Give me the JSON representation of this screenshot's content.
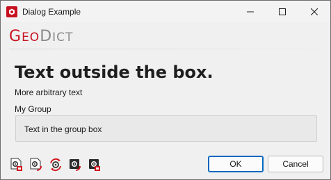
{
  "window": {
    "title": "Dialog Example"
  },
  "logo": {
    "geo_first": "G",
    "geo_rest": "EO",
    "dict_first": "D",
    "dict_rest": "ICT"
  },
  "main": {
    "heading": "Text outside the box.",
    "subtext": "More arbitrary text",
    "group_label": "My Group",
    "group_text": "Text in the group box"
  },
  "buttons": {
    "ok": "OK",
    "cancel": "Cancel"
  },
  "toolbar": {
    "icons": [
      "gear-pdf-icon",
      "gear-export-icon",
      "gear-refresh-icon",
      "gear-dark-export-icon",
      "gear-dark-pdf-icon"
    ]
  },
  "colors": {
    "brand_red": "#c8101e",
    "accent_blue": "#0067c0",
    "logo_gray": "#8a8a8a"
  }
}
